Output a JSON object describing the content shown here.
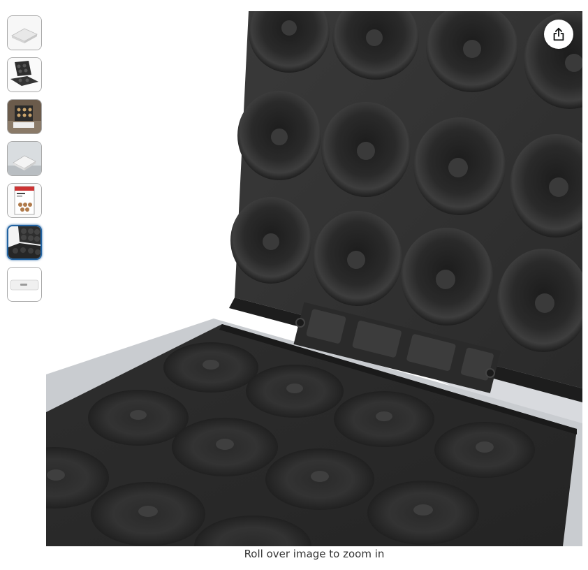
{
  "gallery": {
    "thumbnails": [
      {
        "icon": "closed-white-maker-thumbnail",
        "selected": false
      },
      {
        "icon": "open-maker-thumbnail",
        "selected": false
      },
      {
        "icon": "lifestyle-photo-thumbnail",
        "selected": false
      },
      {
        "icon": "white-maker-angle-thumbnail",
        "selected": false
      },
      {
        "icon": "packaging-box-thumbnail",
        "selected": false
      },
      {
        "icon": "donut-plates-closeup-thumbnail",
        "selected": true
      },
      {
        "icon": "side-view-thumbnail",
        "selected": false
      }
    ]
  },
  "main_image": {
    "icon": "donut-maker-open-plates-image"
  },
  "share_button": {
    "icon": "share-icon"
  },
  "caption": {
    "zoom_hint": "Roll over image to zoom in"
  },
  "colors": {
    "selected_border": "#2162a1",
    "plate": "#2c2c2c",
    "background": "#ffffff"
  }
}
